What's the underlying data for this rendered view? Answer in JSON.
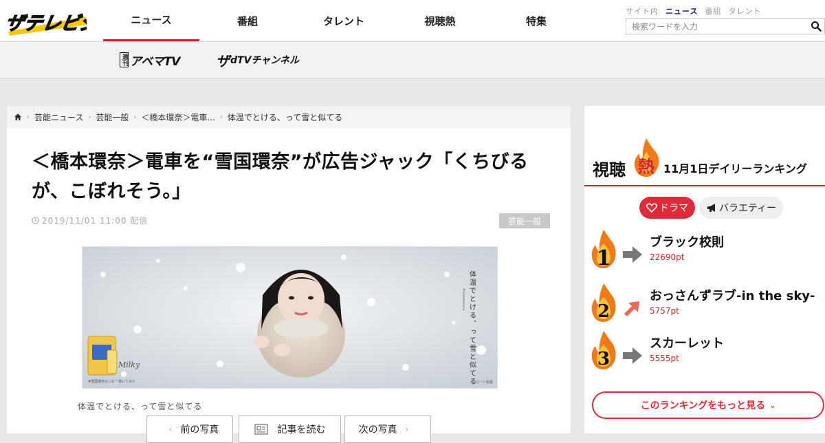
{
  "header": {
    "logo_alt": "ザテレビジョン",
    "nav": [
      {
        "label": "ニュース",
        "active": true
      },
      {
        "label": "番組",
        "active": false
      },
      {
        "label": "タレント",
        "active": false
      },
      {
        "label": "視聴熱",
        "active": false
      },
      {
        "label": "特集",
        "active": false
      }
    ],
    "search_scope": [
      {
        "label": "サイト内",
        "active": false
      },
      {
        "label": "ニュース",
        "active": true
      },
      {
        "label": "番組",
        "active": false
      },
      {
        "label": "タレント",
        "active": false
      }
    ],
    "search_placeholder": "検索ワードを入力"
  },
  "subnav": {
    "abema": {
      "badge": "週刊",
      "label": "アベマTV"
    },
    "dtv": {
      "prefix": "ザ",
      "label": "dTVチャンネル"
    }
  },
  "article": {
    "breadcrumbs": [
      "芸能ニュース",
      "芸能一般",
      "＜橋本環奈＞電車...",
      "体温でとける、って雪と似てる"
    ],
    "title": "＜橋本環奈＞電車を“雪国環奈”が広告ジャック「くちびるが、こぼれそう。」",
    "datetime": "2019/11/01 11:00",
    "datetime_suffix": "配信",
    "category": "芸能一般",
    "ad_copy": "体温でとける、って雪と似てる",
    "ad_sub": "#snowkanna",
    "ad_small": "#雪国環奈のコピー書いてみた",
    "ad_brand": "ロート製薬",
    "caption": "体温でとける、って雪と似てる",
    "buttons": {
      "prev": "前の写真",
      "read": "記事を読む",
      "next": "次の写真"
    }
  },
  "ranking": {
    "title_prefix": "視聴",
    "title_flame": "熱",
    "subtitle": "11月1日デイリーランキング",
    "tabs": [
      {
        "label": "ドラマ",
        "icon": "heart-icon",
        "active": true
      },
      {
        "label": "バラエティー",
        "icon": "megaphone-icon",
        "active": false
      }
    ],
    "items": [
      {
        "rank": "1",
        "trend": "flat",
        "title": "ブラック校則",
        "points": "22690pt"
      },
      {
        "rank": "2",
        "trend": "up",
        "title": "おっさんずラブ-in the sky-",
        "points": "5757pt"
      },
      {
        "rank": "3",
        "trend": "flat",
        "title": "スカーレット",
        "points": "5555pt"
      }
    ],
    "more_label": "このランキングをもっと見る"
  },
  "colors": {
    "accent": "#d8202a",
    "logo_yellow": "#f5c800"
  }
}
